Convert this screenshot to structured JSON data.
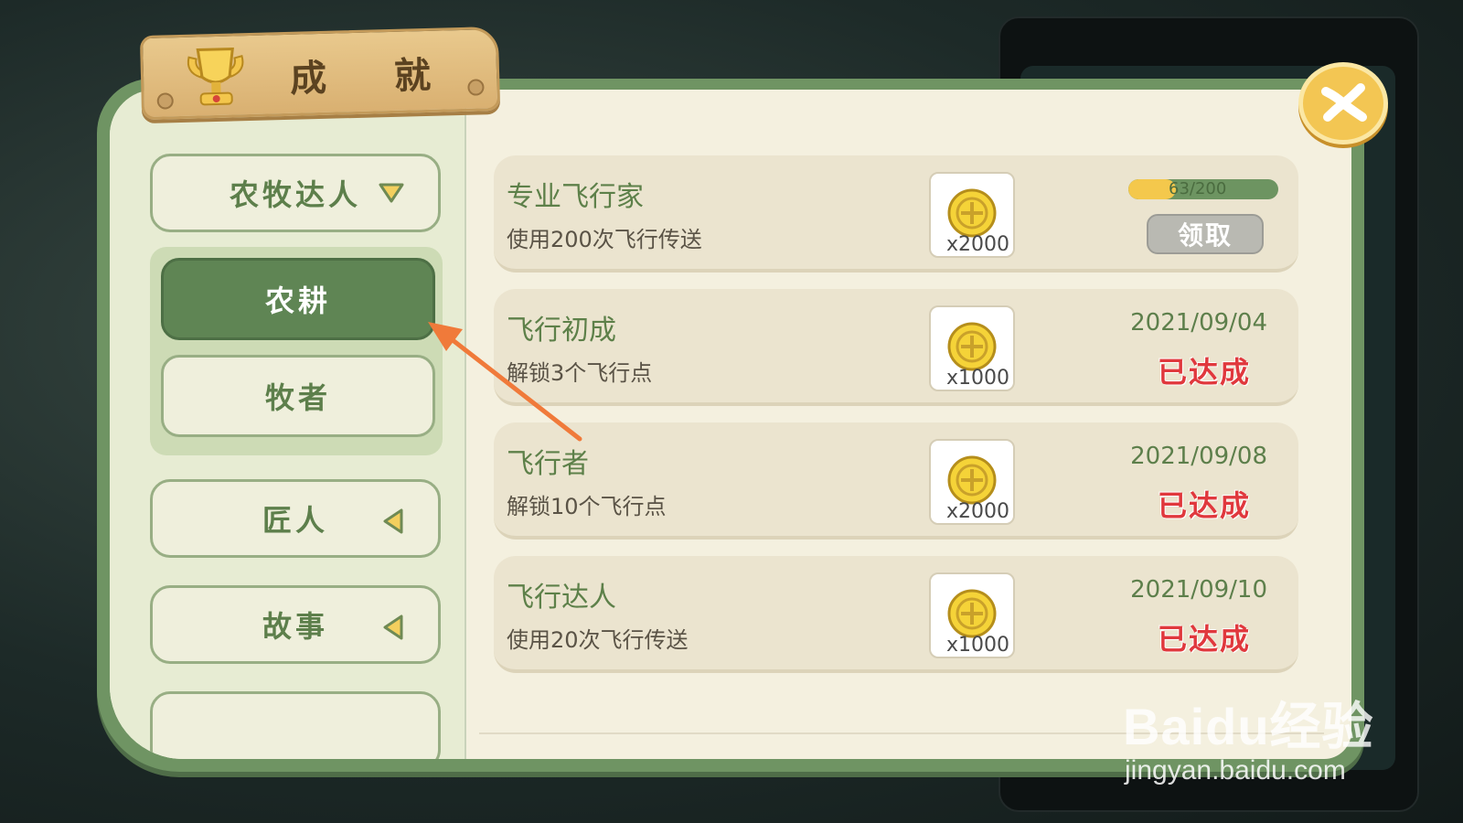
{
  "header": {
    "title": "成 就"
  },
  "sidebar": {
    "categories": [
      {
        "label": "农牧达人",
        "arrow": "down"
      },
      {
        "label": "匠人",
        "arrow": "left"
      },
      {
        "label": "故事",
        "arrow": "left"
      }
    ],
    "subcategories": [
      {
        "label": "农耕",
        "active": true
      },
      {
        "label": "牧者",
        "active": false
      }
    ]
  },
  "achievements": [
    {
      "title": "专业飞行家",
      "desc": "使用200次飞行传送",
      "reward_qty": "x2000",
      "progress_text": "63/200",
      "progress": 0.315,
      "claim_label": "领取",
      "date": "",
      "status": ""
    },
    {
      "title": "飞行初成",
      "desc": "解锁3个飞行点",
      "reward_qty": "x1000",
      "date": "2021/09/04",
      "status": "已达成"
    },
    {
      "title": "飞行者",
      "desc": "解锁10个飞行点",
      "reward_qty": "x2000",
      "date": "2021/09/08",
      "status": "已达成"
    },
    {
      "title": "飞行达人",
      "desc": "使用20次飞行传送",
      "reward_qty": "x1000",
      "date": "2021/09/10",
      "status": "已达成"
    }
  ],
  "watermark": {
    "logo": "Baidu经验",
    "url": "jingyan.baidu.com"
  },
  "colors": {
    "panel_green": "#6f9463",
    "active_tab": "#5f8554",
    "status_red": "#e0383d",
    "close_yellow": "#f3c653",
    "annotation_arrow": "#f07a3a"
  },
  "icons": [
    "trophy-icon",
    "close-icon",
    "coin-icon",
    "triangle-down-icon",
    "triangle-left-icon"
  ]
}
